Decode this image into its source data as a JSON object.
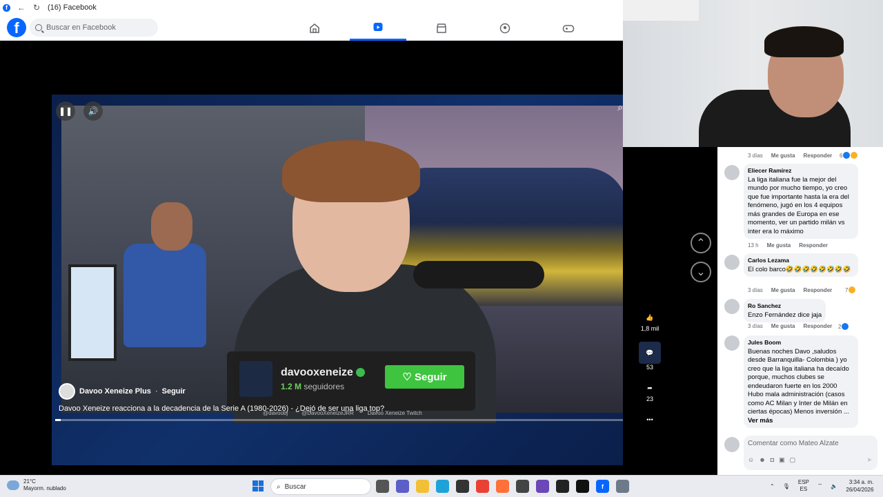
{
  "window": {
    "title": "(16) Facebook"
  },
  "header": {
    "search_placeholder": "Buscar en Facebook",
    "nav": [
      "home",
      "reels",
      "marketplace",
      "groups",
      "gaming"
    ]
  },
  "video": {
    "channel_name": "Davoo Xeneize Plus",
    "follow_label": "Seguir",
    "title": "Davoo Xeneize reacciona a la decadencia de la Serie A (1980-2026) - ¿Dejó de ser una liga top?",
    "progress_fraction": 0.01,
    "overlay": {
      "name": "davooxeneize",
      "subs_count": "1.2 M",
      "subs_label": "seguidores",
      "follow_button": "Seguir"
    },
    "socials": [
      "@davoobj",
      "@DavooXeneizeJRR",
      "Davoo Xeneize Twitch"
    ]
  },
  "actions": {
    "likes": "1,8 mil",
    "comments": "53",
    "shares": "23"
  },
  "comments": [
    {
      "meta_time": "3 días",
      "like": "Me gusta",
      "reply": "Responder",
      "reacts": "6"
    },
    {
      "name": "Eliecer Ramírez",
      "text": "La liga italiana fue la mejor del mundo por mucho tiempo, yo creo que fue importante hasta la era del fenómeno, jugó en los 4 equipos más grandes de Europa en ese momento, ver un partido milán vs inter era lo máximo",
      "time": "13 h",
      "like": "Me gusta",
      "reply": "Responder"
    },
    {
      "name": "Carlos Lezama",
      "text": "El colo barco🤣🤣🤣🤣🤣🤣🤣🤣",
      "time": "3 días",
      "like": "Me gusta",
      "reply": "Responder",
      "reacts": "7"
    },
    {
      "name": "Ro Sanchez",
      "text": "Enzo Fernández dice jaja",
      "time": "3 días",
      "like": "Me gusta",
      "reply": "Responder",
      "reacts": "2"
    },
    {
      "name": "Jules Boom",
      "text": "Buenas noches Davo ,saludos desde Barranquilla- Colombia ) yo creo que la liga italiana ha decaído porque, muchos clubes se endeudaron fuerte en los 2000 Hubo mala administración (casos como AC Milan y Inter de Milán en ciertas épocas) Menos inversión ...",
      "see_more": "Ver más"
    }
  ],
  "compose": {
    "placeholder": "Comentar como Mateo Alzate"
  },
  "taskbar": {
    "temp": "21°C",
    "weather": "Mayorm. nublado",
    "search": "Buscar",
    "lang_top": "ESP",
    "lang_bottom": "ES",
    "time": "3:34 a. m.",
    "date": "26/04/2026"
  },
  "colors": {
    "fb_blue": "#0866ff",
    "follow_green": "#3ec43e"
  }
}
